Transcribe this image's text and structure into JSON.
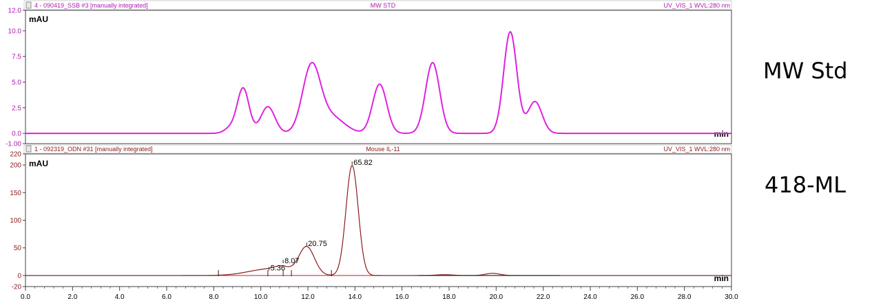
{
  "side_labels": {
    "top": "MW Std",
    "bottom": "418-ML"
  },
  "colors": {
    "top_trace": "#e020e0",
    "bottom_trace": "#8b1a1a",
    "baseline": "#c02020",
    "header_top": "#b01ab0",
    "header_bottom": "#8b1a1a"
  },
  "chart_data": [
    {
      "type": "line",
      "header": {
        "left": "4 - 090419_SSB #3 [manually integrated]",
        "center": "MW STD",
        "right": "UV_VIS_1 WVL:280 nm"
      },
      "ylabel": "mAU",
      "xlabel": "min",
      "ylim": [
        -1.0,
        12.0
      ],
      "xlim": [
        0,
        30
      ],
      "y_ticks": [
        "-1.00",
        "0.0",
        "2.5",
        "5.0",
        "7.5",
        "10.0",
        "12.0"
      ],
      "baseline": 0,
      "peaks": [
        {
          "rt": 8.7,
          "height": 0.5,
          "width": 0.25
        },
        {
          "rt": 9.25,
          "height": 4.4,
          "width": 0.25
        },
        {
          "rt": 10.3,
          "height": 2.6,
          "width": 0.3
        },
        {
          "rt": 12.15,
          "height": 6.4,
          "width": 0.38
        },
        {
          "rt": 13.0,
          "height": 1.6,
          "width": 0.55
        },
        {
          "rt": 15.05,
          "height": 4.8,
          "width": 0.3
        },
        {
          "rt": 17.3,
          "height": 6.9,
          "width": 0.3
        },
        {
          "rt": 20.6,
          "height": 9.9,
          "width": 0.28
        },
        {
          "rt": 21.65,
          "height": 3.1,
          "width": 0.3
        }
      ]
    },
    {
      "type": "line",
      "header": {
        "left": "1 - 092319_ODN #31 [manually integrated]",
        "center": "Mouse IL-11",
        "right": "UV_VIS_1 WVL:280 nm"
      },
      "ylabel": "mAU",
      "xlabel": "min",
      "ylim": [
        -20,
        220
      ],
      "xlim": [
        0,
        30
      ],
      "y_ticks": [
        "-20",
        "0",
        "50",
        "100",
        "150",
        "200",
        "220"
      ],
      "x_ticks": [
        "0.0",
        "2.0",
        "4.0",
        "6.0",
        "8.0",
        "10.0",
        "12.0",
        "14.0",
        "16.0",
        "18.0",
        "20.0",
        "22.0",
        "24.0",
        "26.0",
        "28.0",
        "30.0"
      ],
      "baseline": 0,
      "peaks": [
        {
          "rt": 10.4,
          "height": 12,
          "width": 0.9
        },
        {
          "rt": 10.9,
          "height": 7,
          "width": 0.3
        },
        {
          "rt": 11.95,
          "height": 50,
          "width": 0.33
        },
        {
          "rt": 13.88,
          "height": 199,
          "width": 0.26
        },
        {
          "rt": 17.8,
          "height": 1.5,
          "width": 0.35
        },
        {
          "rt": 19.85,
          "height": 4,
          "width": 0.3
        }
      ],
      "peak_labels": [
        {
          "x": 10.35,
          "y": 13,
          "text": "5.36"
        },
        {
          "x": 10.95,
          "y": 26,
          "text": "8.07"
        },
        {
          "x": 11.95,
          "y": 57,
          "text": "20.75"
        },
        {
          "x": 13.88,
          "y": 204,
          "text": "65.82"
        }
      ],
      "integration_marks": [
        8.2,
        10.3,
        10.95,
        11.3,
        13.0
      ],
      "baseline_segment": [
        16.7,
        22.7
      ]
    }
  ]
}
